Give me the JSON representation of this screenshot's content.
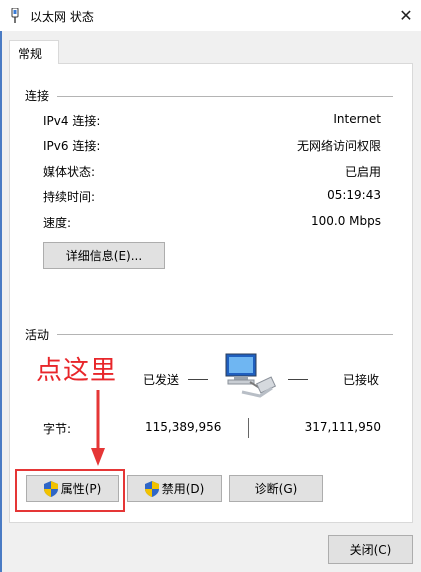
{
  "window": {
    "title": "以太网 状态",
    "close": "✕"
  },
  "tab": {
    "label": "常规"
  },
  "connection": {
    "section_label": "连接",
    "rows": [
      {
        "label": "IPv4 连接:",
        "value": "Internet"
      },
      {
        "label": "IPv6 连接:",
        "value": "无网络访问权限"
      },
      {
        "label": "媒体状态:",
        "value": "已启用"
      },
      {
        "label": "持续时间:",
        "value": "05:19:43"
      },
      {
        "label": "速度:",
        "value": "100.0 Mbps"
      }
    ],
    "details_button": "详细信息(E)..."
  },
  "activity": {
    "section_label": "活动",
    "sent_label": "已发送",
    "received_label": "已接收",
    "bytes_label": "字节:",
    "bytes_sent": "115,389,956",
    "bytes_received": "317,111,950",
    "network_icon": "network-computers-icon"
  },
  "annotation": {
    "text": "点这里",
    "color": "#e8262a"
  },
  "buttons": {
    "properties": "属性(P)",
    "disable": "禁用(D)",
    "diagnose": "诊断(G)",
    "close": "关闭(C)"
  },
  "colors": {
    "accent": "#4a7bc4",
    "annotation_red": "#e53636"
  }
}
